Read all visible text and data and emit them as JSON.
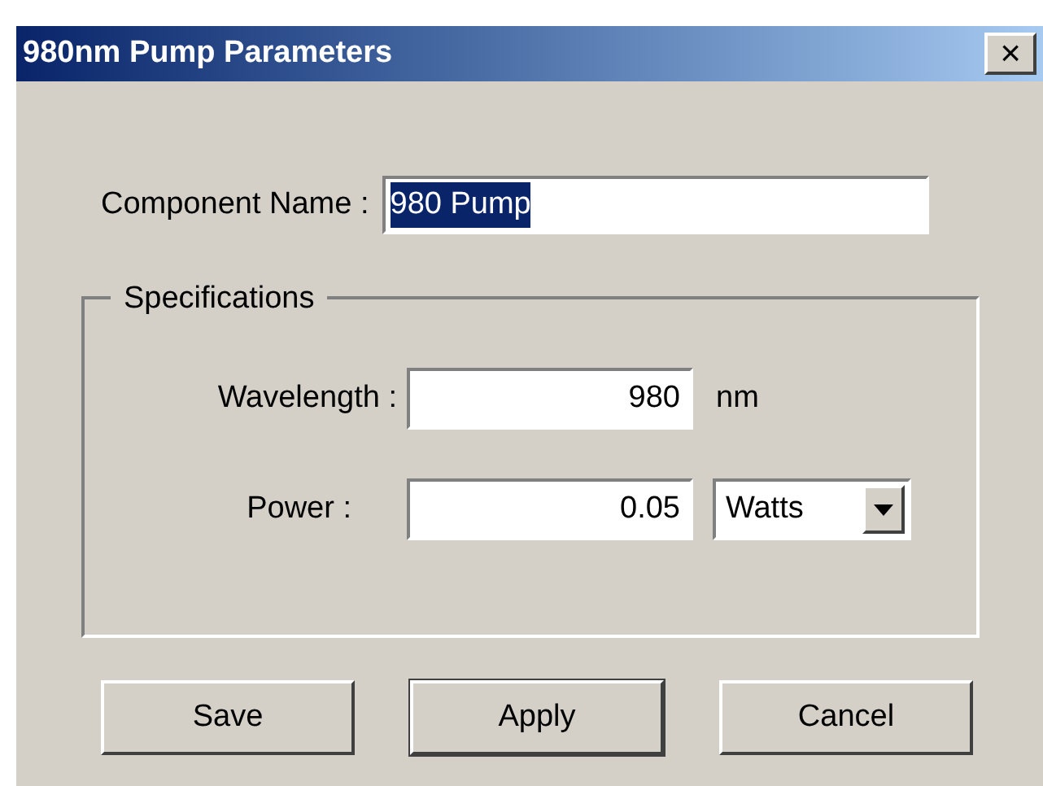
{
  "window": {
    "title": "980nm Pump Parameters",
    "close": "×"
  },
  "component_name": {
    "label": "Component Name :",
    "value": "980 Pump",
    "selected": true
  },
  "specifications": {
    "title": "Specifications",
    "wavelength": {
      "label": "Wavelength :",
      "value": "980",
      "unit": "nm"
    },
    "power": {
      "label": "Power :",
      "value": "0.05",
      "unit": "Watts"
    }
  },
  "buttons": [
    "Save",
    "Apply",
    "Cancel"
  ]
}
